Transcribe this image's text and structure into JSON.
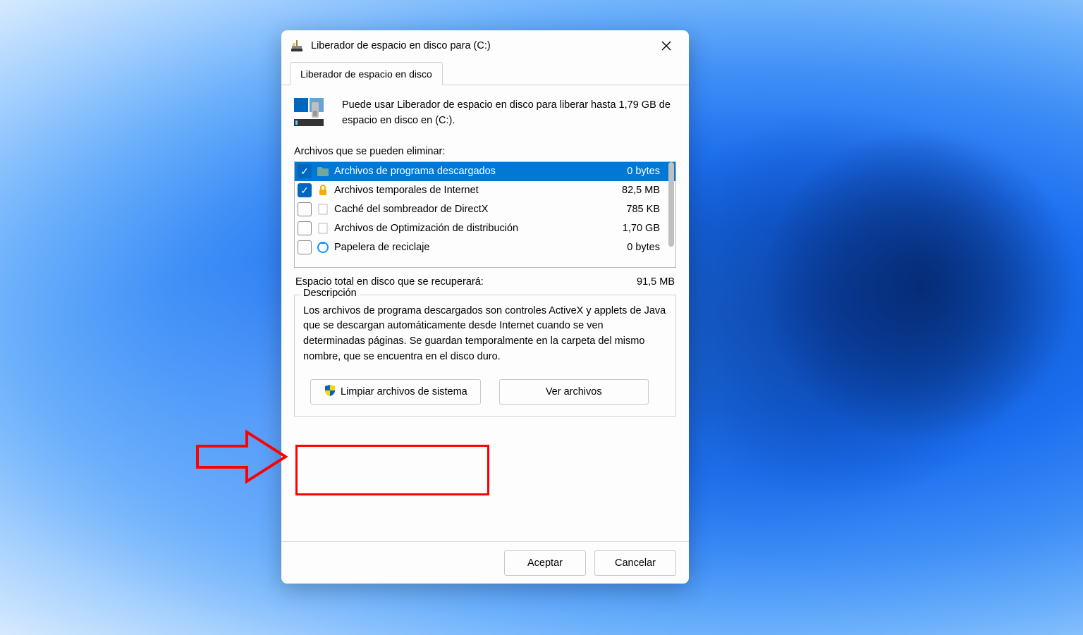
{
  "window": {
    "title": "Liberador de espacio en disco para  (C:)"
  },
  "tab": {
    "label": "Liberador de espacio en disco"
  },
  "intro": "Puede usar Liberador de espacio en disco para liberar hasta 1,79 GB de espacio en disco en  (C:).",
  "list_label": "Archivos que se pueden eliminar:",
  "files": [
    {
      "name": "Archivos de programa descargados",
      "size": "0 bytes",
      "checked": true,
      "selected": true,
      "icon": "folder"
    },
    {
      "name": "Archivos temporales de Internet",
      "size": "82,5 MB",
      "checked": true,
      "selected": false,
      "icon": "lock"
    },
    {
      "name": "Caché del sombreador de DirectX",
      "size": "785 KB",
      "checked": false,
      "selected": false,
      "icon": "blank"
    },
    {
      "name": "Archivos de Optimización de distribución",
      "size": "1,70 GB",
      "checked": false,
      "selected": false,
      "icon": "blank"
    },
    {
      "name": "Papelera de reciclaje",
      "size": "0 bytes",
      "checked": false,
      "selected": false,
      "icon": "recycle"
    }
  ],
  "total": {
    "label": "Espacio total en disco que se recuperará:",
    "value": "91,5 MB"
  },
  "description": {
    "legend": "Descripción",
    "text": "Los archivos de programa descargados son controles ActiveX y applets de Java que se descargan automáticamente desde Internet cuando se ven determinadas páginas. Se guardan temporalmente en la carpeta del mismo nombre, que se encuentra en el disco duro."
  },
  "buttons": {
    "clean_system": "Limpiar archivos de sistema",
    "view_files": "Ver archivos",
    "ok": "Aceptar",
    "cancel": "Cancelar"
  }
}
